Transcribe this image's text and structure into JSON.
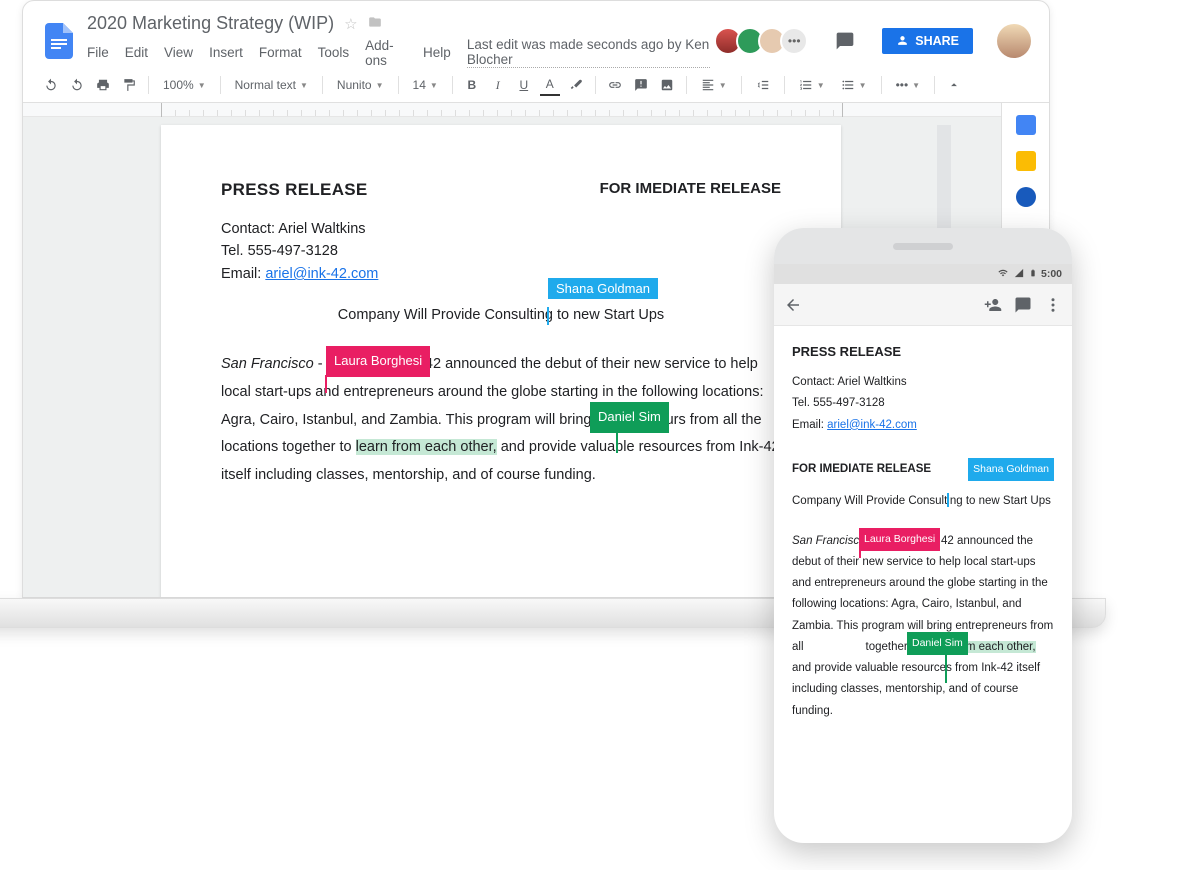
{
  "header": {
    "title": "2020 Marketing Strategy (WIP)",
    "share_label": "SHARE",
    "avatar_more": "•••"
  },
  "menu": {
    "file": "File",
    "edit": "Edit",
    "view": "View",
    "insert": "Insert",
    "format": "Format",
    "tools": "Tools",
    "addons": "Add-ons",
    "help": "Help",
    "status": "Last edit was made seconds ago by Ken Blocher"
  },
  "toolbar": {
    "zoom": "100%",
    "style": "Normal text",
    "font": "Nunito",
    "size": "14",
    "bold": "B",
    "italic": "I",
    "underline": "U",
    "tcolor": "A"
  },
  "doc": {
    "h_left": "PRESS RELEASE",
    "h_right": "FOR IMEDIATE RELEASE",
    "contact": "Contact: Ariel Waltkins",
    "tel": "Tel. 555-497-3128",
    "email_label": "Email: ",
    "email": "ariel@ink-42.com",
    "subtitle_a": "Company Will Provide Consulting",
    "subtitle_b": " to new Start Ups",
    "p_loc": "San Francisco",
    "p_sep": " - ",
    "p1": "42 announced the debut of their new service to help local start-ups and entrepreneurs around the globe starting in the following locations: Agra, Cairo, Istanbul, and Zambia. This program will bring entrepreneurs from all the locations together to ",
    "p1_hl": "learn from each other,",
    "p1_end": " and provide valuable resources from Ink-42 itself including classes, mentorship, and of course funding."
  },
  "collab": {
    "shana": "Shana Goldman",
    "laura": "Laura Borghesi",
    "daniel": "Daniel Sim"
  },
  "phone": {
    "time": "5:00",
    "h": "PRESS RELEASE",
    "contact": "Contact: Ariel Waltkins",
    "tel": "Tel. 555-497-3128",
    "email_label": "Email: ",
    "email": "ariel@ink-42.com",
    "sec": "FOR IMEDIATE RELEASE",
    "sub": "Company Will Provide Consulting",
    "sub_b": " to new Start Ups",
    "loc": "San Francisco",
    "body_a": " k 42 announced the debut of their new service to help local start-ups and entrepreneurs around the globe starting in the following locations: Agra, Cairo, Istanbul, and Zambia. This program will bring entrepreneurs from all ",
    "body_b": " together ",
    "body_hl": "to learn from each other,",
    "body_c": " and provide valuable resources from Ink-42 itself including classes, mentorship, and of course funding."
  }
}
